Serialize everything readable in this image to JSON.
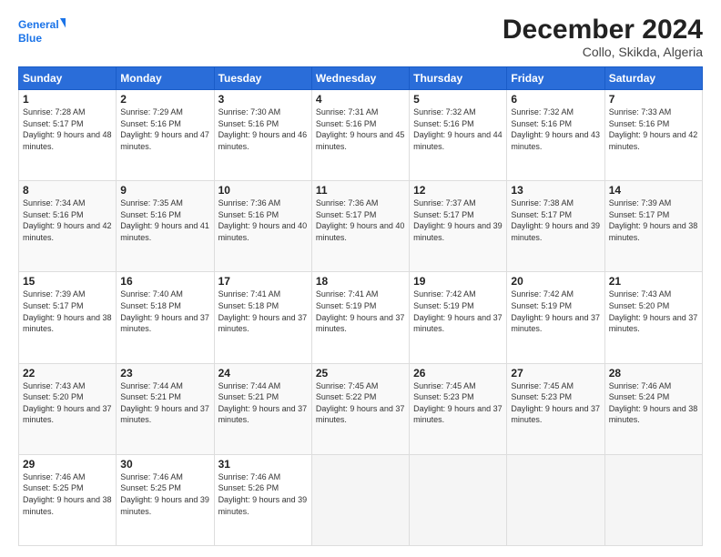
{
  "logo": {
    "line1": "General",
    "line2": "Blue"
  },
  "title": "December 2024",
  "subtitle": "Collo, Skikda, Algeria",
  "days_header": [
    "Sunday",
    "Monday",
    "Tuesday",
    "Wednesday",
    "Thursday",
    "Friday",
    "Saturday"
  ],
  "weeks": [
    [
      {
        "num": "1",
        "sunrise": "7:28 AM",
        "sunset": "5:17 PM",
        "daylight": "9 hours and 48 minutes."
      },
      {
        "num": "2",
        "sunrise": "7:29 AM",
        "sunset": "5:16 PM",
        "daylight": "9 hours and 47 minutes."
      },
      {
        "num": "3",
        "sunrise": "7:30 AM",
        "sunset": "5:16 PM",
        "daylight": "9 hours and 46 minutes."
      },
      {
        "num": "4",
        "sunrise": "7:31 AM",
        "sunset": "5:16 PM",
        "daylight": "9 hours and 45 minutes."
      },
      {
        "num": "5",
        "sunrise": "7:32 AM",
        "sunset": "5:16 PM",
        "daylight": "9 hours and 44 minutes."
      },
      {
        "num": "6",
        "sunrise": "7:32 AM",
        "sunset": "5:16 PM",
        "daylight": "9 hours and 43 minutes."
      },
      {
        "num": "7",
        "sunrise": "7:33 AM",
        "sunset": "5:16 PM",
        "daylight": "9 hours and 42 minutes."
      }
    ],
    [
      {
        "num": "8",
        "sunrise": "7:34 AM",
        "sunset": "5:16 PM",
        "daylight": "9 hours and 42 minutes."
      },
      {
        "num": "9",
        "sunrise": "7:35 AM",
        "sunset": "5:16 PM",
        "daylight": "9 hours and 41 minutes."
      },
      {
        "num": "10",
        "sunrise": "7:36 AM",
        "sunset": "5:16 PM",
        "daylight": "9 hours and 40 minutes."
      },
      {
        "num": "11",
        "sunrise": "7:36 AM",
        "sunset": "5:17 PM",
        "daylight": "9 hours and 40 minutes."
      },
      {
        "num": "12",
        "sunrise": "7:37 AM",
        "sunset": "5:17 PM",
        "daylight": "9 hours and 39 minutes."
      },
      {
        "num": "13",
        "sunrise": "7:38 AM",
        "sunset": "5:17 PM",
        "daylight": "9 hours and 39 minutes."
      },
      {
        "num": "14",
        "sunrise": "7:39 AM",
        "sunset": "5:17 PM",
        "daylight": "9 hours and 38 minutes."
      }
    ],
    [
      {
        "num": "15",
        "sunrise": "7:39 AM",
        "sunset": "5:17 PM",
        "daylight": "9 hours and 38 minutes."
      },
      {
        "num": "16",
        "sunrise": "7:40 AM",
        "sunset": "5:18 PM",
        "daylight": "9 hours and 37 minutes."
      },
      {
        "num": "17",
        "sunrise": "7:41 AM",
        "sunset": "5:18 PM",
        "daylight": "9 hours and 37 minutes."
      },
      {
        "num": "18",
        "sunrise": "7:41 AM",
        "sunset": "5:19 PM",
        "daylight": "9 hours and 37 minutes."
      },
      {
        "num": "19",
        "sunrise": "7:42 AM",
        "sunset": "5:19 PM",
        "daylight": "9 hours and 37 minutes."
      },
      {
        "num": "20",
        "sunrise": "7:42 AM",
        "sunset": "5:19 PM",
        "daylight": "9 hours and 37 minutes."
      },
      {
        "num": "21",
        "sunrise": "7:43 AM",
        "sunset": "5:20 PM",
        "daylight": "9 hours and 37 minutes."
      }
    ],
    [
      {
        "num": "22",
        "sunrise": "7:43 AM",
        "sunset": "5:20 PM",
        "daylight": "9 hours and 37 minutes."
      },
      {
        "num": "23",
        "sunrise": "7:44 AM",
        "sunset": "5:21 PM",
        "daylight": "9 hours and 37 minutes."
      },
      {
        "num": "24",
        "sunrise": "7:44 AM",
        "sunset": "5:21 PM",
        "daylight": "9 hours and 37 minutes."
      },
      {
        "num": "25",
        "sunrise": "7:45 AM",
        "sunset": "5:22 PM",
        "daylight": "9 hours and 37 minutes."
      },
      {
        "num": "26",
        "sunrise": "7:45 AM",
        "sunset": "5:23 PM",
        "daylight": "9 hours and 37 minutes."
      },
      {
        "num": "27",
        "sunrise": "7:45 AM",
        "sunset": "5:23 PM",
        "daylight": "9 hours and 37 minutes."
      },
      {
        "num": "28",
        "sunrise": "7:46 AM",
        "sunset": "5:24 PM",
        "daylight": "9 hours and 38 minutes."
      }
    ],
    [
      {
        "num": "29",
        "sunrise": "7:46 AM",
        "sunset": "5:25 PM",
        "daylight": "9 hours and 38 minutes."
      },
      {
        "num": "30",
        "sunrise": "7:46 AM",
        "sunset": "5:25 PM",
        "daylight": "9 hours and 39 minutes."
      },
      {
        "num": "31",
        "sunrise": "7:46 AM",
        "sunset": "5:26 PM",
        "daylight": "9 hours and 39 minutes."
      },
      null,
      null,
      null,
      null
    ]
  ]
}
